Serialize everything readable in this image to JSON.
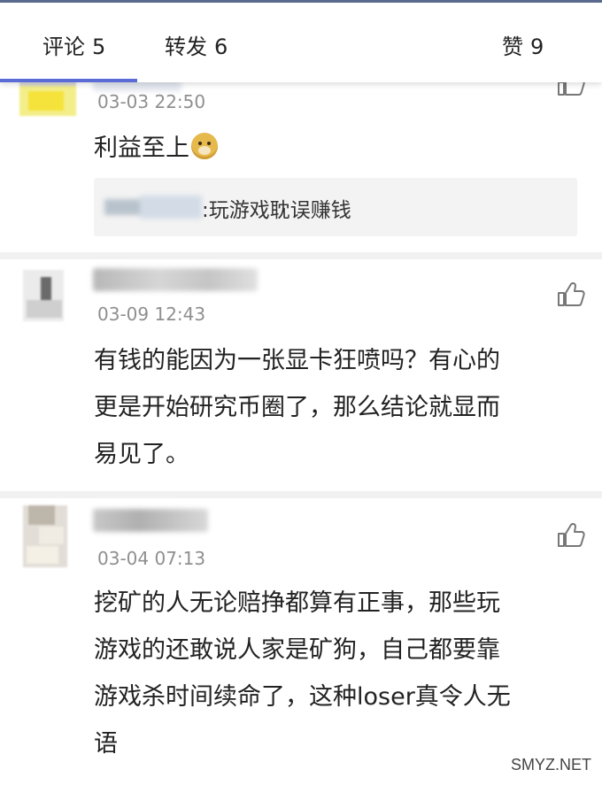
{
  "tabs": {
    "comments": {
      "label": "评论",
      "count": "5"
    },
    "reposts": {
      "label": "转发",
      "count": "6"
    },
    "likes": {
      "label": "赞",
      "count": "9"
    }
  },
  "comments": [
    {
      "time": "03-03 22:50",
      "text": "利益至上",
      "emoji": "doge-icon",
      "reply": {
        "text": ":玩游戏耽误赚钱"
      }
    },
    {
      "time": "03-09 12:43",
      "lines": [
        "有钱的能因为一张显卡狂喷吗？有心的",
        "更是开始研究币圈了，那么结论就显而",
        "易见了。"
      ]
    },
    {
      "time": "03-04 07:13",
      "lines": [
        "挖矿的人无论赔挣都算有正事，那些玩",
        "游戏的还敢说人家是矿狗，自己都要靠",
        "游戏杀时间续命了，这种loser真令人无",
        "语"
      ]
    }
  ],
  "watermark": "SMYZ.NET",
  "colors": {
    "accent": "#5b6cd6",
    "top_bar": "#5a6a8e",
    "time": "#8f8f8f",
    "divider": "#f1f1f1"
  }
}
